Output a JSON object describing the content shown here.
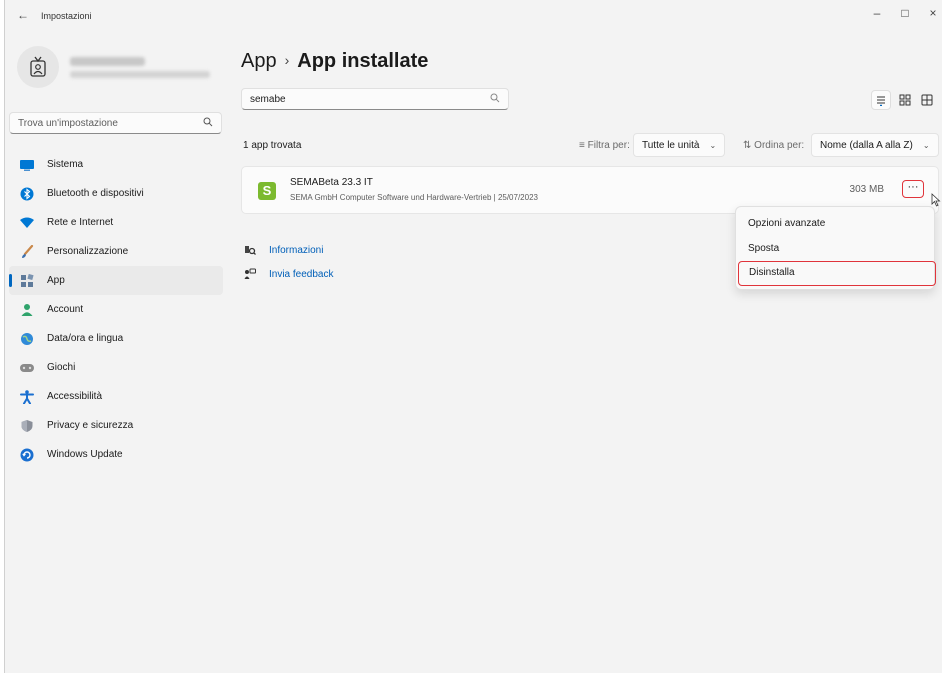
{
  "window": {
    "title": "Impostazioni",
    "back_icon": "←",
    "minimize_icon": "–",
    "maximize_icon": "□",
    "close_icon": "×"
  },
  "sidebar": {
    "search_placeholder": "Trova un'impostazione",
    "items": [
      {
        "label": "Sistema",
        "icon": "monitor-icon",
        "color": "#0078d4"
      },
      {
        "label": "Bluetooth e dispositivi",
        "icon": "bluetooth-icon",
        "color": "#0078d4"
      },
      {
        "label": "Rete e Internet",
        "icon": "wifi-icon",
        "color": "#0078d4"
      },
      {
        "label": "Personalizzazione",
        "icon": "brush-icon",
        "color": "#d18a4a"
      },
      {
        "label": "App",
        "icon": "apps-icon",
        "color": "#5e7a9a",
        "active": true
      },
      {
        "label": "Account",
        "icon": "person-icon",
        "color": "#2fa36b"
      },
      {
        "label": "Data/ora e lingua",
        "icon": "globe-clock-icon",
        "color": "#2f8ad8"
      },
      {
        "label": "Giochi",
        "icon": "gamepad-icon",
        "color": "#8a8a8a"
      },
      {
        "label": "Accessibilità",
        "icon": "accessibility-icon",
        "color": "#1a6fd0"
      },
      {
        "label": "Privacy e sicurezza",
        "icon": "shield-icon",
        "color": "#8a8f99"
      },
      {
        "label": "Windows Update",
        "icon": "update-icon",
        "color": "#1a6fd0"
      }
    ]
  },
  "main": {
    "breadcrumb_parent": "App",
    "breadcrumb_sep": "›",
    "breadcrumb_current": "App installate",
    "search_value": "semabe",
    "result_count": "1 app trovata",
    "filter_label": "Filtra per:",
    "filter_value": "Tutte le unità",
    "sort_label": "Ordina per:",
    "sort_value": "Nome (dalla A alla Z)",
    "chevron": "⌄",
    "app": {
      "logo_letter": "S",
      "name": "SEMABeta 23.3 IT",
      "meta": "SEMA GmbH Computer Software und Hardware-Vertrieb  |  25/07/2023",
      "size": "303 MB",
      "more": "···"
    },
    "links": [
      {
        "label": "Informazioni",
        "icon": "info-search-icon"
      },
      {
        "label": "Invia feedback",
        "icon": "feedback-icon"
      }
    ],
    "context_menu": [
      "Opzioni avanzate",
      "Sposta",
      "Disinstalla"
    ]
  },
  "accent_color": "#0067c0",
  "highlight_color": "#e0343b"
}
